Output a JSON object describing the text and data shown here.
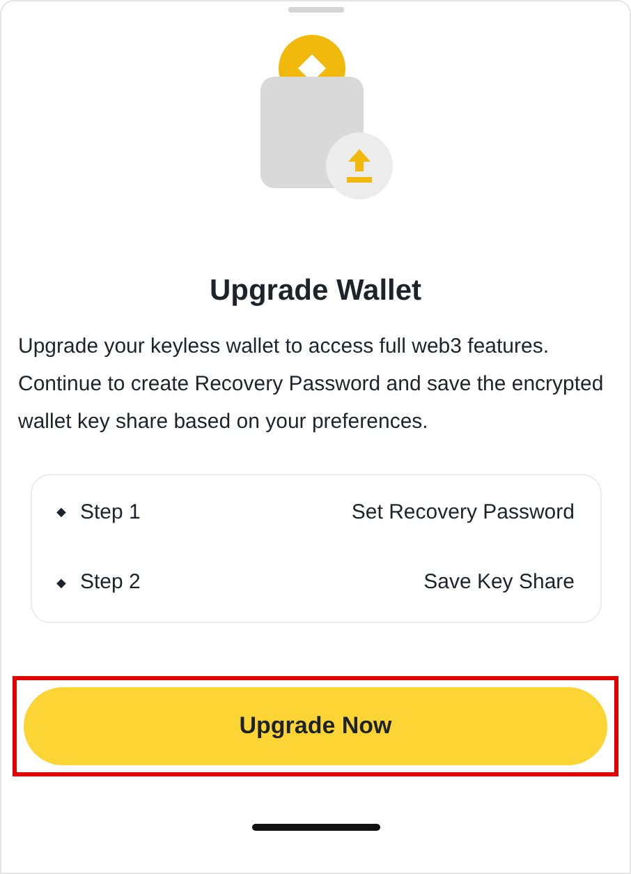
{
  "title": "Upgrade Wallet",
  "description": "Upgrade your keyless wallet to access full web3 features. Continue to create Recovery Password and save the encrypted wallet key share based on your preferences.",
  "steps": [
    {
      "bullet": "◆",
      "label": "Step 1",
      "action": "Set Recovery Password"
    },
    {
      "bullet": "◆",
      "label": "Step 2",
      "action": "Save Key Share"
    }
  ],
  "button": {
    "label": "Upgrade Now",
    "highlighted": true
  }
}
